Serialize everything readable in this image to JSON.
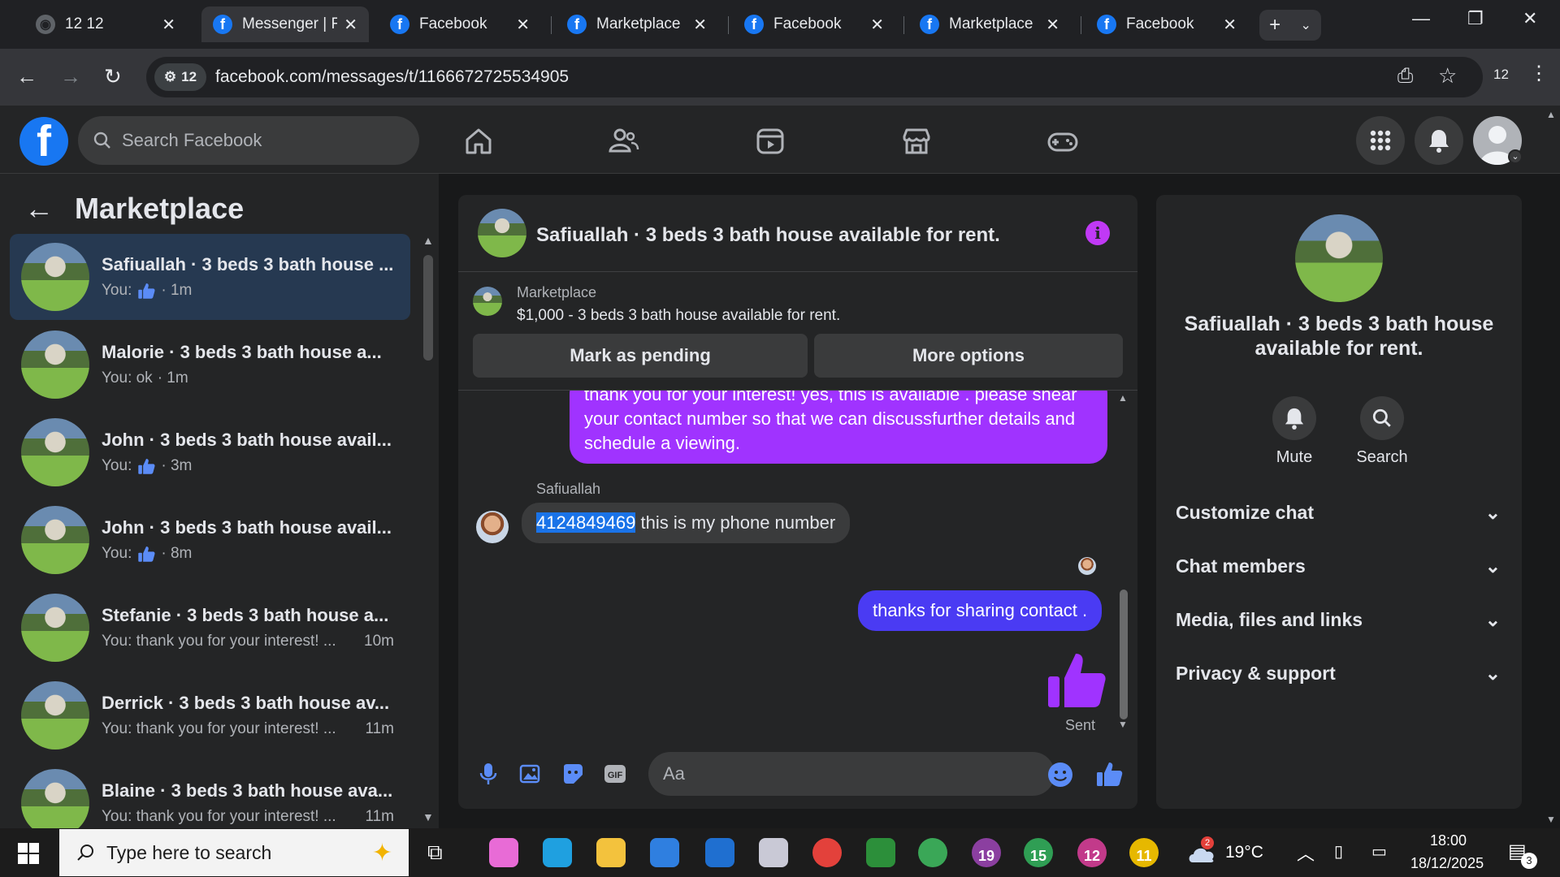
{
  "tabs": [
    {
      "title": "12 12",
      "favicon": "globe-icon"
    },
    {
      "title": "Messenger | F",
      "favicon": "facebook-icon",
      "active": true
    },
    {
      "title": "Facebook",
      "favicon": "facebook-icon"
    },
    {
      "title": "Marketplace ·",
      "favicon": "facebook-icon"
    },
    {
      "title": "Facebook",
      "favicon": "facebook-icon"
    },
    {
      "title": "Marketplace ·",
      "favicon": "facebook-icon"
    },
    {
      "title": "Facebook",
      "favicon": "facebook-icon"
    }
  ],
  "browser": {
    "url": "facebook.com/messages/t/1166672725534905",
    "site_chip": "12",
    "profile_label": "12"
  },
  "fb": {
    "search_placeholder": "Search Facebook"
  },
  "left": {
    "title": "Marketplace",
    "conversations": [
      {
        "name": "Safiuallah · 3 beds 3 bath house ...",
        "prefix": "You:",
        "like": true,
        "time": "· 1m",
        "selected": true
      },
      {
        "name": "Malorie · 3 beds 3 bath house a...",
        "prefix": "You: ok",
        "like": false,
        "time": "· 1m"
      },
      {
        "name": "John · 3 beds 3 bath house avail...",
        "prefix": "You:",
        "like": true,
        "time": "· 3m"
      },
      {
        "name": "John · 3 beds 3 bath house avail...",
        "prefix": "You:",
        "like": true,
        "time": "· 8m"
      },
      {
        "name": "Stefanie · 3 beds 3 bath house a...",
        "prefix": "You: thank you for your interest! ...",
        "like": false,
        "time": "10m"
      },
      {
        "name": "Derrick · 3 beds 3 bath house av...",
        "prefix": "You: thank you for your interest! ...",
        "like": false,
        "time": "11m"
      },
      {
        "name": "Blaine · 3 beds 3 bath house ava...",
        "prefix": "You: thank you for your interest! ...",
        "like": false,
        "time": "11m"
      }
    ]
  },
  "chat": {
    "title": "Safiuallah · 3 beds 3 bath house available for rent.",
    "marketplace_label": "Marketplace",
    "listing": "$1,000 - 3 beds 3 bath house available for rent.",
    "mark_pending": "Mark as pending",
    "more_options": "More options",
    "outgoing_1": "thank you for your interest! yes, this is available . please shear your contact number so that we can discussfurther details and schedule a viewing.",
    "sender_name": "Safiuallah",
    "incoming_number": "4124849469",
    "incoming_rest": " this is my phone number",
    "outgoing_2": "thanks for sharing contact .",
    "sent_status": "Sent",
    "input_placeholder": "Aa",
    "accent": "#a033ff",
    "bubble_blue": "#4a3bf3"
  },
  "right": {
    "title": "Safiuallah · 3 beds 3 bath house available for rent.",
    "mute": "Mute",
    "search": "Search",
    "sections": [
      "Customize chat",
      "Chat members",
      "Media, files and links",
      "Privacy & support"
    ]
  },
  "taskbar": {
    "search_placeholder": "Type here to search",
    "weather": "19°C",
    "weather_badge": "2",
    "time": "18:00",
    "date": "18/12/2025",
    "notif_count": "3",
    "apps": [
      {
        "name": "copilot-icon",
        "color": "#e86bd6"
      },
      {
        "name": "edge-icon",
        "color": "#1fa0e0"
      },
      {
        "name": "file-explorer-icon",
        "color": "#f3c23d"
      },
      {
        "name": "store-icon",
        "color": "#2f7fe0"
      },
      {
        "name": "outlook-icon",
        "color": "#1f6fd0"
      },
      {
        "name": "paint-icon",
        "color": "#c9c9d6"
      },
      {
        "name": "chrome-icon",
        "color": "#e3413b"
      },
      {
        "name": "app-ix-icon",
        "color": "#2c8f3a"
      },
      {
        "name": "chrome-profile-icon",
        "color": "#3aa757"
      },
      {
        "name": "chrome-profile-19-icon",
        "color": "#8b3fa0",
        "badge": "19"
      },
      {
        "name": "chrome-profile-15-icon",
        "color": "#2f9e54",
        "badge": "15"
      },
      {
        "name": "chrome-profile-12-icon",
        "color": "#c23a8a",
        "badge": "12"
      },
      {
        "name": "chrome-profile-11-icon",
        "color": "#e6b800",
        "badge": "11"
      }
    ]
  }
}
